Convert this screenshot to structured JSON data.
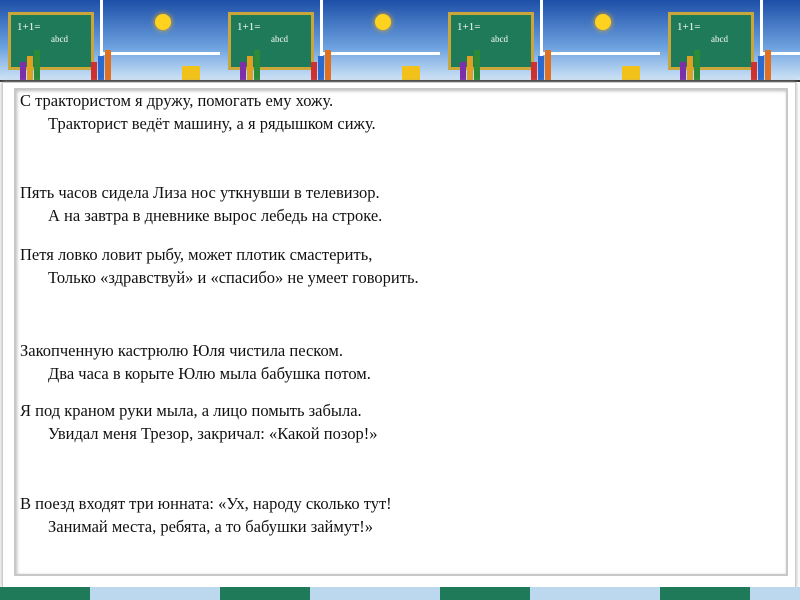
{
  "banner": {
    "board_text": "1+1=",
    "board_text2": "abcd"
  },
  "stanzas": [
    {
      "l1": "С трактористом я дружу, помогать ему хожу.",
      "l2": "Тракторист ведёт машину, а я рядышком сижу."
    },
    {
      "l1": "Пять часов сидела Лиза нос уткнувши в телевизор.",
      "l2": "А на завтра в дневнике вырос лебедь на строке."
    },
    {
      "l1": "Петя ловко ловит рыбу, может плотик смастерить,",
      "l2": "Только «здравствуй» и «спасибо» не умеет говорить."
    },
    {
      "l1": "Закопченную кастрюлю Юля чистила песком.",
      "l2": "Два часа в корыте Юлю мыла бабушка потом."
    },
    {
      "l1": "Я под краном руки мыла, а лицо помыть забыла.",
      "l2": "Увидал меня Трезор, закричал: «Какой позор!»"
    },
    {
      "l1": "В поезд входят три юнната: «Ух, народу сколько тут!",
      "l2": "Занимай места, ребята, а то бабушки займут!»"
    }
  ]
}
